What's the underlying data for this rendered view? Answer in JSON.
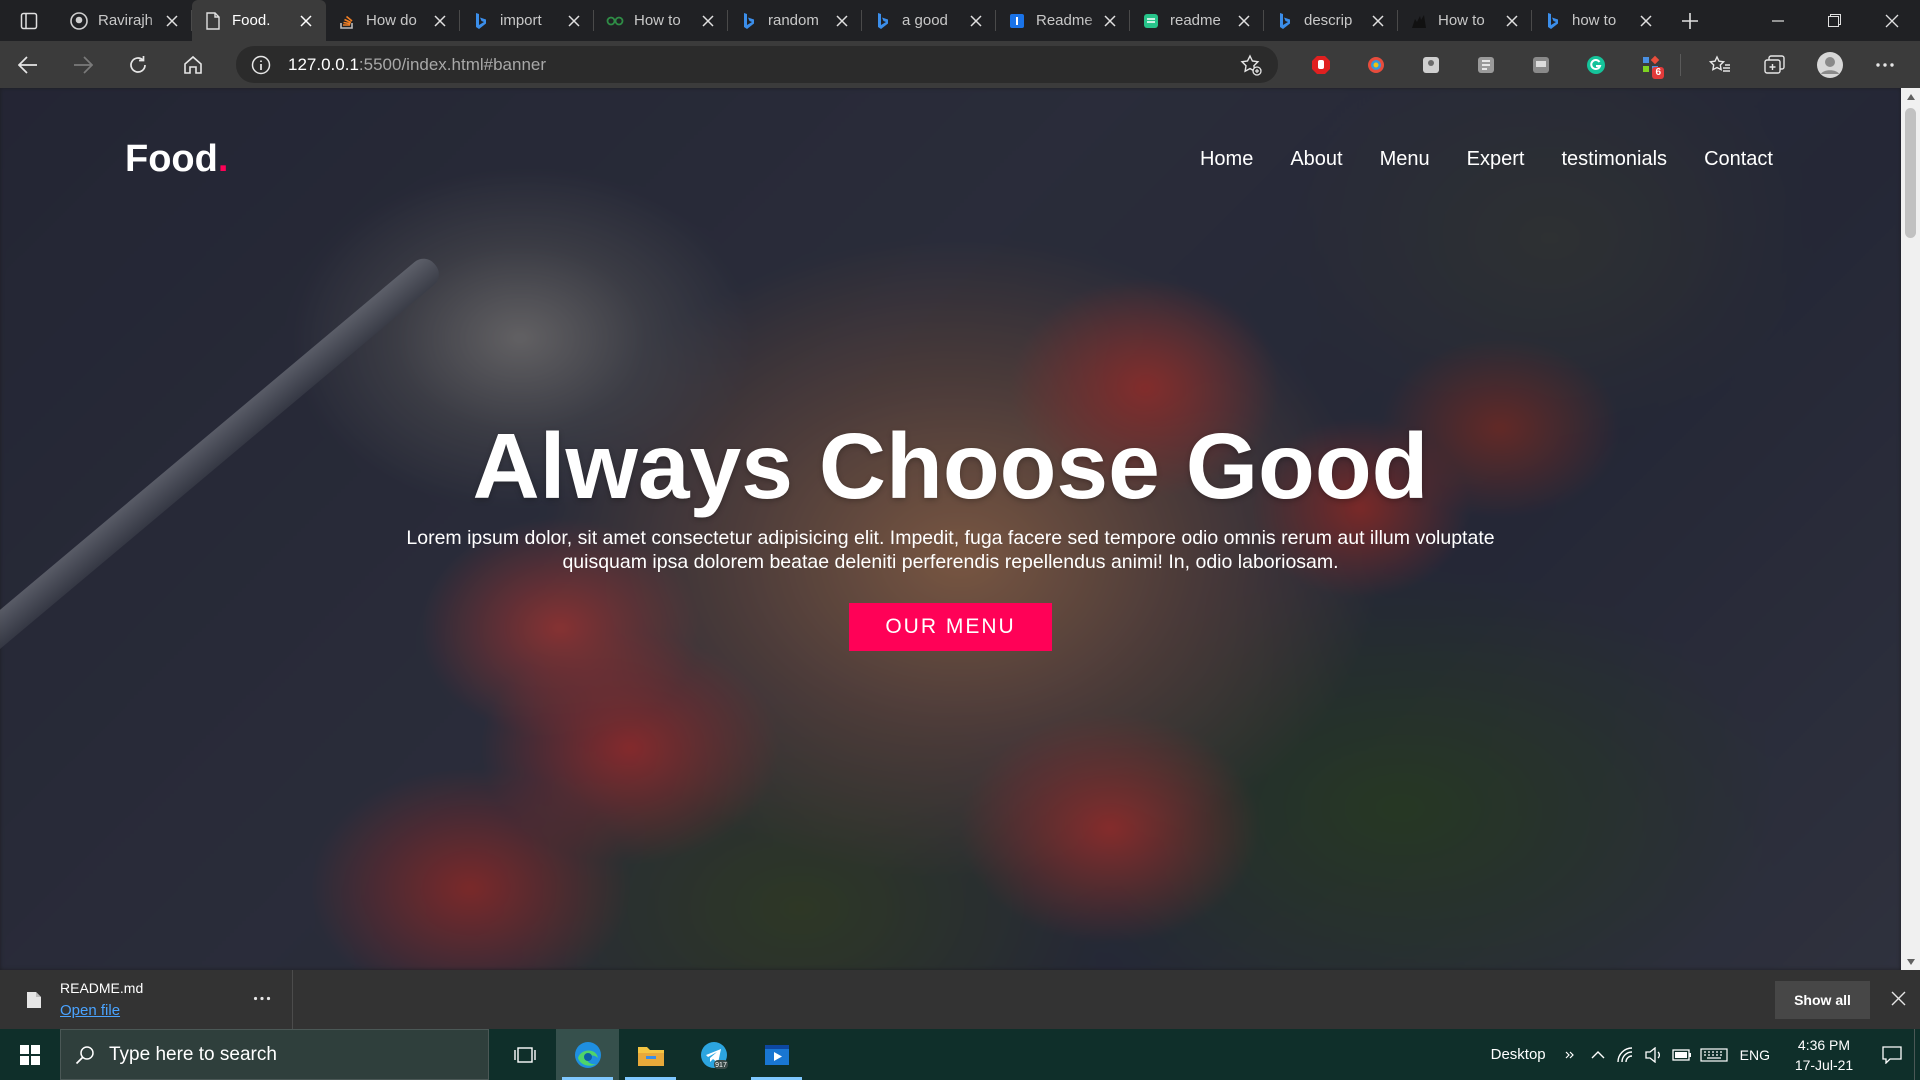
{
  "browser": {
    "tabs": [
      {
        "title": "Ravirajh",
        "favicon": "github-icon",
        "active": false
      },
      {
        "title": "Food.",
        "favicon": "page-icon",
        "active": true
      },
      {
        "title": "How do",
        "favicon": "stackoverflow-icon",
        "active": false
      },
      {
        "title": "import",
        "favicon": "bing-icon",
        "active": false
      },
      {
        "title": "How to",
        "favicon": "geeks-icon",
        "active": false
      },
      {
        "title": "random",
        "favicon": "bing-icon",
        "active": false
      },
      {
        "title": "a good",
        "favicon": "bing-icon",
        "active": false
      },
      {
        "title": "Readme",
        "favicon": "readme-icon",
        "active": false
      },
      {
        "title": "readme",
        "favicon": "green-doc-icon",
        "active": false
      },
      {
        "title": "descrip",
        "favicon": "bing-icon",
        "active": false
      },
      {
        "title": "How to",
        "favicon": "cat-icon",
        "active": false
      },
      {
        "title": "how to",
        "favicon": "bing-icon",
        "active": false
      }
    ],
    "url_host": "127.0.0.1",
    "url_path": ":5500/index.html#banner",
    "extension_badge": "6"
  },
  "page": {
    "logo": {
      "text": "Food",
      "dot": "."
    },
    "nav": [
      "Home",
      "About",
      "Menu",
      "Expert",
      "testimonials",
      "Contact"
    ],
    "hero_title": "Always Choose Good",
    "hero_text": "Lorem ipsum dolor, sit amet consectetur adipisicing elit. Impedit, fuga facere sed tempore odio omnis rerum aut illum voluptate quisquam ipsa dolorem beatae deleniti perferendis repellendus animi! In, odio laboriosam.",
    "hero_button": "OUR MENU"
  },
  "download_bar": {
    "file_name": "README.md",
    "open_link": "Open file",
    "show_all": "Show all"
  },
  "taskbar": {
    "search_placeholder": "Type here to search",
    "telegram_badge": "917",
    "desktop_label": "Desktop",
    "language": "ENG",
    "time": "4:36 PM",
    "date": "17-Jul-21"
  },
  "colors": {
    "accent": "#ff0157",
    "tabstrip": "#202124",
    "toolbar": "#3b3b3b",
    "taskbar": "#0f2f2a"
  }
}
